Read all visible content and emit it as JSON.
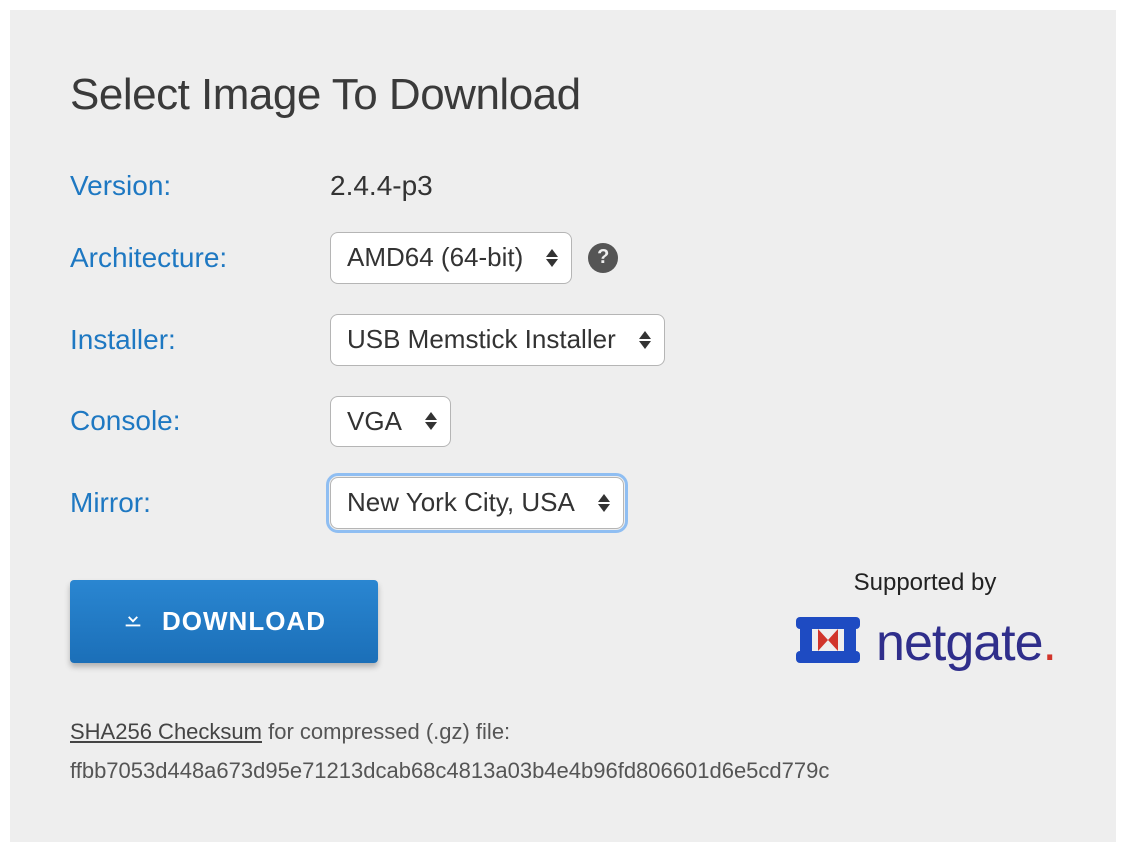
{
  "heading": "Select Image To Download",
  "fields": {
    "version": {
      "label": "Version:",
      "value": "2.4.4-p3"
    },
    "architecture": {
      "label": "Architecture:",
      "selected": "AMD64 (64-bit)"
    },
    "installer": {
      "label": "Installer:",
      "selected": "USB Memstick Installer"
    },
    "console": {
      "label": "Console:",
      "selected": "VGA"
    },
    "mirror": {
      "label": "Mirror:",
      "selected": "New York City, USA"
    }
  },
  "download_button": "DOWNLOAD",
  "sponsor": {
    "supported_by": "Supported by",
    "name": "netgate"
  },
  "checksum": {
    "label": "SHA256 Checksum",
    "suffix": " for compressed (.gz) file:",
    "hash": "ffbb7053d448a673d95e71213dcab68c4813a03b4e4b96fd806601d6e5cd779c"
  }
}
